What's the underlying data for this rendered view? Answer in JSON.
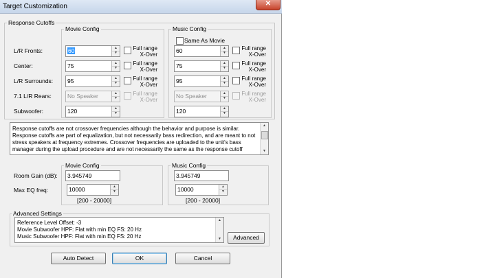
{
  "window": {
    "title": "Target Customization",
    "close_glyph": "✕"
  },
  "response_cutoffs": {
    "group_label": "Response Cutoffs",
    "movie_label": "Movie Config",
    "music_label": "Music Config",
    "same_as_movie": "Same As Movie",
    "rows": [
      {
        "label": "L/R Fronts:",
        "movie": "60",
        "music": "60",
        "full_range": [
          "Full range",
          "X-Over"
        ],
        "enabled": true
      },
      {
        "label": "Center:",
        "movie": "75",
        "music": "75",
        "full_range": [
          "Full range",
          "X-Over"
        ],
        "enabled": true
      },
      {
        "label": "L/R Surrounds:",
        "movie": "95",
        "music": "95",
        "full_range": [
          "Full range",
          "X-Over"
        ],
        "enabled": true
      },
      {
        "label": "7.1 L/R Rears:",
        "movie": "No Speaker",
        "music": "No Speaker",
        "full_range": [
          "Full range",
          "X-Over"
        ],
        "enabled": false
      },
      {
        "label": "Subwoofer:",
        "movie": "120",
        "music": "120",
        "enabled": true
      }
    ]
  },
  "description": [
    "Response cutoffs are not crossover frequencies although the behavior and purpose is similar.",
    "Response cutoffs are part of equalization, but not necessarily bass redirection, and are meant to not",
    "stress speakers at frequency extremes.  Crossover frequencies are uploaded to the unit's bass",
    "manager during the upload procedure and are not necessarily the same as the response cutoff"
  ],
  "room": {
    "movie_label": "Movie Config",
    "music_label": "Music Config",
    "room_gain_label": "Room Gain (dB):",
    "max_eq_label": "Max EQ freq:",
    "movie_gain": "3.945749",
    "music_gain": "3.945749",
    "movie_eq": "10000",
    "music_eq": "10000",
    "range": "[200 - 20000]"
  },
  "advanced": {
    "group_label": "Advanced Settings",
    "lines": [
      "Reference Level Offset: -3",
      "Movie Subwoofer HPF: Flat with min EQ FS: 20 Hz",
      "Music Subwoofer HPF: Flat with min EQ FS: 20 Hz"
    ],
    "button": "Advanced"
  },
  "buttons": {
    "auto_detect": "Auto Detect",
    "ok": "OK",
    "cancel": "Cancel"
  }
}
